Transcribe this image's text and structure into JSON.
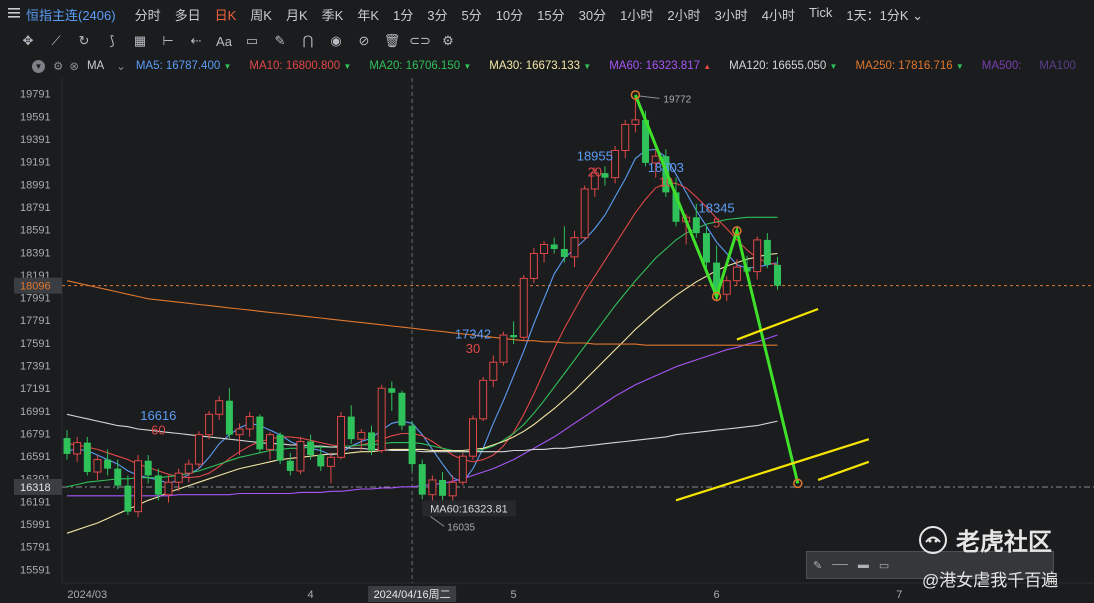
{
  "toolbar": {
    "symbol": "恒指主连(2406)",
    "periods": [
      "分时",
      "多日",
      "日K",
      "周K",
      "月K",
      "季K",
      "年K",
      "1分",
      "3分",
      "5分",
      "10分",
      "15分",
      "30分",
      "1小时",
      "2小时",
      "3小时",
      "4小时",
      "Tick",
      "1天：1分K ⌄"
    ],
    "active_period": "日K",
    "tools": [
      "move-icon",
      "line-tool-icon",
      "curve-icon",
      "zigzag-icon",
      "grid-icon",
      "measure-icon",
      "arrow-icon",
      "text-icon",
      "comment-icon",
      "pen-icon",
      "magnet-icon",
      "eye-icon",
      "hide-icon",
      "trash-icon",
      "toggle-icon",
      "settings-icon"
    ]
  },
  "indicator_bar": {
    "name": "MA",
    "items": [
      {
        "label": "MA5:",
        "value": "16787.400",
        "color": "#5b9df5",
        "arrow": "▼"
      },
      {
        "label": "MA10:",
        "value": "16800.800",
        "color": "#e04848",
        "arrow": "▼"
      },
      {
        "label": "MA20:",
        "value": "16706.150",
        "color": "#2fc15a",
        "arrow": "▼"
      },
      {
        "label": "MA30:",
        "value": "16673.133",
        "color": "#f3e7a5",
        "arrow": "▼"
      },
      {
        "label": "MA60:",
        "value": "16323.817",
        "color": "#a855f7",
        "arrow": "▲"
      },
      {
        "label": "MA120:",
        "value": "16655.050",
        "color": "#d6d6d6",
        "arrow": "▼"
      },
      {
        "label": "MA250:",
        "value": "17816.716",
        "color": "#e0772e",
        "arrow": "▼"
      },
      {
        "label": "MA500:",
        "value": "",
        "color": "#7a3fb0",
        "arrow": ""
      },
      {
        "label": "MA100",
        "value": "",
        "color": "#5a3f8a",
        "arrow": ""
      }
    ]
  },
  "chart_data": {
    "type": "candlestick",
    "y_ticks": [
      19791,
      19591,
      19391,
      19191,
      18991,
      18791,
      18591,
      18391,
      18191,
      17991,
      17791,
      17591,
      17391,
      17191,
      16991,
      16791,
      16591,
      16391,
      16191,
      15991,
      15791,
      15591
    ],
    "ylim": [
      15470,
      19930
    ],
    "x_labels": [
      {
        "i": 2,
        "text": "2024/03"
      },
      {
        "i": 24,
        "text": "4"
      },
      {
        "i": 34,
        "text": "2024/04/16周二",
        "highlight": true
      },
      {
        "i": 44,
        "text": "5"
      },
      {
        "i": 64,
        "text": "6"
      },
      {
        "i": 82,
        "text": "7"
      }
    ],
    "current_price": 18096,
    "crosshair_price": 16318,
    "crosshair_index": 34,
    "crosshair_ma_label": "MA60:16323.81",
    "low_label": "16035",
    "high_label": "19772",
    "candles": [
      [
        16750,
        16820,
        16560,
        16610
      ],
      [
        16610,
        16760,
        16540,
        16710
      ],
      [
        16710,
        16760,
        16420,
        16450
      ],
      [
        16450,
        16600,
        16380,
        16560
      ],
      [
        16560,
        16650,
        16420,
        16480
      ],
      [
        16480,
        16560,
        16300,
        16330
      ],
      [
        16330,
        16420,
        16070,
        16100
      ],
      [
        16100,
        16600,
        16050,
        16550
      ],
      [
        16550,
        16600,
        16350,
        16420
      ],
      [
        16420,
        16480,
        16200,
        16250
      ],
      [
        16250,
        16420,
        16180,
        16360
      ],
      [
        16360,
        16480,
        16280,
        16440
      ],
      [
        16440,
        16560,
        16360,
        16520
      ],
      [
        16520,
        16810,
        16480,
        16780
      ],
      [
        16780,
        16990,
        16740,
        16960
      ],
      [
        16960,
        17120,
        16910,
        17080
      ],
      [
        17080,
        17190,
        16750,
        16780
      ],
      [
        16780,
        16880,
        16600,
        16830
      ],
      [
        16830,
        16980,
        16760,
        16940
      ],
      [
        16940,
        16960,
        16620,
        16650
      ],
      [
        16650,
        16800,
        16560,
        16780
      ],
      [
        16780,
        16800,
        16520,
        16550
      ],
      [
        16550,
        16620,
        16420,
        16460
      ],
      [
        16460,
        16760,
        16430,
        16720
      ],
      [
        16720,
        16780,
        16560,
        16600
      ],
      [
        16600,
        16680,
        16460,
        16500
      ],
      [
        16500,
        16620,
        16350,
        16580
      ],
      [
        16580,
        16980,
        16560,
        16940
      ],
      [
        16940,
        17040,
        16700,
        16740
      ],
      [
        16740,
        16830,
        16640,
        16800
      ],
      [
        16800,
        16860,
        16600,
        16640
      ],
      [
        16640,
        17220,
        16620,
        17190
      ],
      [
        17190,
        17250,
        16990,
        17150
      ],
      [
        17150,
        17170,
        16820,
        16860
      ],
      [
        16860,
        16900,
        16460,
        16520
      ],
      [
        16520,
        16560,
        16210,
        16250
      ],
      [
        16250,
        16420,
        16110,
        16380
      ],
      [
        16380,
        16450,
        16200,
        16240
      ],
      [
        16240,
        16420,
        16180,
        16360
      ],
      [
        16360,
        16620,
        16330,
        16590
      ],
      [
        16590,
        16950,
        16560,
        16920
      ],
      [
        16920,
        17290,
        16900,
        17260
      ],
      [
        17260,
        17480,
        17200,
        17420
      ],
      [
        17420,
        17690,
        17390,
        17660
      ],
      [
        17660,
        17780,
        17580,
        17640
      ],
      [
        17640,
        18190,
        17610,
        18160
      ],
      [
        18160,
        18430,
        18120,
        18380
      ],
      [
        18380,
        18490,
        18300,
        18460
      ],
      [
        18460,
        18520,
        18380,
        18420
      ],
      [
        18420,
        18620,
        18300,
        18350
      ],
      [
        18350,
        18580,
        18260,
        18520
      ],
      [
        18520,
        18980,
        18500,
        18950
      ],
      [
        18950,
        19140,
        18880,
        19090
      ],
      [
        19090,
        19150,
        18980,
        19050
      ],
      [
        19050,
        19330,
        19000,
        19290
      ],
      [
        19290,
        19560,
        19220,
        19520
      ],
      [
        19520,
        19770,
        19450,
        19560
      ],
      [
        19560,
        19640,
        19150,
        19180
      ],
      [
        19180,
        19300,
        19050,
        19240
      ],
      [
        19240,
        19300,
        18880,
        18920
      ],
      [
        18920,
        19050,
        18620,
        18660
      ],
      [
        18660,
        18730,
        18460,
        18700
      ],
      [
        18700,
        18820,
        18520,
        18560
      ],
      [
        18560,
        18620,
        18250,
        18300
      ],
      [
        18300,
        18450,
        18000,
        18020
      ],
      [
        18020,
        18180,
        17960,
        18140
      ],
      [
        18140,
        18330,
        18100,
        18260
      ],
      [
        18260,
        18360,
        18180,
        18220
      ],
      [
        18220,
        18530,
        18150,
        18500
      ],
      [
        18500,
        18560,
        18250,
        18280
      ],
      [
        18280,
        18350,
        18060,
        18096
      ]
    ],
    "series": [
      {
        "name": "MA5",
        "color": "#5b9df5",
        "values": [
          16640,
          16650,
          16640,
          16600,
          16560,
          16520,
          16460,
          16420,
          16400,
          16380,
          16350,
          16380,
          16430,
          16480,
          16580,
          16700,
          16780,
          16840,
          16880,
          16860,
          16820,
          16780,
          16720,
          16680,
          16660,
          16640,
          16600,
          16620,
          16680,
          16720,
          16750,
          16820,
          16880,
          16900,
          16880,
          16780,
          16650,
          16520,
          16400,
          16360,
          16480,
          16660,
          16880,
          17080,
          17300,
          17520,
          17760,
          17980,
          18200,
          18340,
          18420,
          18500,
          18600,
          18720,
          18880,
          19040,
          19220,
          19290,
          19300,
          19230,
          19080,
          18920,
          18760,
          18620,
          18480,
          18380,
          18280,
          18250,
          18260,
          18280,
          18300
        ]
      },
      {
        "name": "MA10",
        "color": "#e04848",
        "values": [
          16700,
          16690,
          16670,
          16650,
          16620,
          16590,
          16560,
          16520,
          16490,
          16460,
          16430,
          16410,
          16400,
          16410,
          16440,
          16500,
          16570,
          16630,
          16680,
          16720,
          16740,
          16760,
          16760,
          16750,
          16730,
          16710,
          16690,
          16680,
          16680,
          16690,
          16710,
          16740,
          16770,
          16790,
          16790,
          16770,
          16720,
          16660,
          16600,
          16560,
          16540,
          16560,
          16600,
          16680,
          16800,
          16960,
          17140,
          17340,
          17540,
          17720,
          17880,
          18040,
          18180,
          18320,
          18460,
          18600,
          18740,
          18860,
          18960,
          19000,
          19000,
          18960,
          18880,
          18790,
          18690,
          18600,
          18500,
          18410,
          18340,
          18300,
          18280
        ]
      },
      {
        "name": "MA20",
        "color": "#2fc15a",
        "values": [
          16320,
          16340,
          16360,
          16370,
          16380,
          16390,
          16390,
          16400,
          16400,
          16400,
          16410,
          16420,
          16440,
          16460,
          16490,
          16520,
          16550,
          16580,
          16600,
          16620,
          16640,
          16650,
          16660,
          16660,
          16670,
          16670,
          16670,
          16680,
          16680,
          16690,
          16690,
          16700,
          16710,
          16710,
          16710,
          16700,
          16680,
          16660,
          16640,
          16630,
          16630,
          16650,
          16680,
          16730,
          16790,
          16870,
          16970,
          17080,
          17200,
          17320,
          17440,
          17560,
          17680,
          17800,
          17920,
          18030,
          18140,
          18240,
          18340,
          18420,
          18500,
          18560,
          18600,
          18640,
          18660,
          18680,
          18690,
          18700,
          18700,
          18700,
          18700
        ]
      },
      {
        "name": "MA30",
        "color": "#f3e7a5",
        "values": [
          15910,
          15940,
          15970,
          16000,
          16040,
          16080,
          16120,
          16160,
          16200,
          16230,
          16270,
          16300,
          16330,
          16360,
          16390,
          16420,
          16450,
          16480,
          16500,
          16520,
          16540,
          16560,
          16570,
          16580,
          16590,
          16600,
          16610,
          16610,
          16620,
          16630,
          16630,
          16640,
          16650,
          16650,
          16650,
          16650,
          16640,
          16640,
          16640,
          16640,
          16650,
          16660,
          16690,
          16720,
          16760,
          16810,
          16870,
          16940,
          17010,
          17090,
          17170,
          17260,
          17350,
          17440,
          17530,
          17620,
          17710,
          17790,
          17870,
          17940,
          18010,
          18070,
          18130,
          18180,
          18230,
          18270,
          18300,
          18330,
          18350,
          18370,
          18380
        ]
      },
      {
        "name": "MA60",
        "color": "#a855f7",
        "values": [
          16240,
          16240,
          16240,
          16240,
          16240,
          16240,
          16240,
          16240,
          16240,
          16240,
          16240,
          16250,
          16250,
          16250,
          16250,
          16250,
          16250,
          16260,
          16260,
          16260,
          16260,
          16260,
          16260,
          16270,
          16270,
          16270,
          16280,
          16280,
          16290,
          16300,
          16300,
          16310,
          16310,
          16320,
          16320,
          16330,
          16340,
          16350,
          16370,
          16390,
          16420,
          16450,
          16480,
          16520,
          16560,
          16610,
          16660,
          16710,
          16760,
          16820,
          16880,
          16940,
          17000,
          17060,
          17120,
          17170,
          17220,
          17260,
          17300,
          17340,
          17380,
          17410,
          17440,
          17470,
          17500,
          17530,
          17550,
          17580,
          17600,
          17630,
          17660
        ]
      },
      {
        "name": "MA120",
        "color": "#d6d6d6",
        "values": [
          16960,
          16940,
          16920,
          16900,
          16880,
          16860,
          16850,
          16830,
          16820,
          16810,
          16800,
          16790,
          16780,
          16770,
          16760,
          16750,
          16740,
          16730,
          16720,
          16710,
          16700,
          16700,
          16690,
          16690,
          16680,
          16680,
          16670,
          16670,
          16660,
          16660,
          16650,
          16650,
          16640,
          16640,
          16640,
          16630,
          16630,
          16630,
          16630,
          16630,
          16630,
          16630,
          16630,
          16630,
          16640,
          16640,
          16650,
          16650,
          16660,
          16660,
          16670,
          16680,
          16690,
          16700,
          16710,
          16720,
          16730,
          16740,
          16750,
          16760,
          16780,
          16790,
          16800,
          16810,
          16820,
          16830,
          16840,
          16850,
          16860,
          16880,
          16900
        ]
      },
      {
        "name": "MA250",
        "color": "#e0772e",
        "values": [
          18140,
          18120,
          18100,
          18080,
          18060,
          18040,
          18020,
          18000,
          17980,
          17970,
          17960,
          17950,
          17940,
          17930,
          17920,
          17910,
          17900,
          17890,
          17880,
          17870,
          17860,
          17850,
          17840,
          17830,
          17820,
          17810,
          17800,
          17790,
          17780,
          17770,
          17760,
          17750,
          17740,
          17730,
          17720,
          17710,
          17700,
          17690,
          17680,
          17670,
          17660,
          17650,
          17640,
          17630,
          17620,
          17610,
          17610,
          17600,
          17600,
          17590,
          17590,
          17590,
          17580,
          17580,
          17580,
          17580,
          17580,
          17570,
          17570,
          17570,
          17570,
          17570,
          17570,
          17570,
          17570,
          17570,
          17570,
          17570,
          17570,
          17570,
          17570
        ]
      }
    ],
    "ma_labels": [
      {
        "i": 9,
        "price": 16910,
        "text": "16616",
        "color": "#5b9df5"
      },
      {
        "i": 9,
        "price": 16780,
        "text": "60",
        "color": "#e04848"
      },
      {
        "i": 40,
        "price": 17630,
        "text": "17342",
        "color": "#5b9df5"
      },
      {
        "i": 40,
        "price": 17500,
        "text": "30",
        "color": "#e04848"
      },
      {
        "i": 52,
        "price": 19200,
        "text": "18955",
        "color": "#5b9df5"
      },
      {
        "i": 52,
        "price": 19060,
        "text": "20",
        "color": "#e04848"
      },
      {
        "i": 59,
        "price": 19100,
        "text": "18803",
        "color": "#5b9df5"
      },
      {
        "i": 59,
        "price": 18970,
        "text": "10",
        "color": "#e04848"
      },
      {
        "i": 64,
        "price": 18740,
        "text": "18345",
        "color": "#5b9df5"
      },
      {
        "i": 64,
        "price": 18610,
        "text": "5",
        "color": "#e04848"
      }
    ],
    "drawing": {
      "pattern": [
        [
          56,
          19780
        ],
        [
          64,
          18000
        ],
        [
          66,
          18580
        ],
        [
          72,
          16350
        ]
      ],
      "channel_upper": [
        [
          66,
          17620
        ],
        [
          74,
          17890
        ]
      ],
      "channel_lower": [
        [
          60,
          16200
        ],
        [
          79,
          16740
        ]
      ],
      "lower_extension": [
        [
          74,
          16380
        ],
        [
          79,
          16540
        ]
      ]
    }
  },
  "watermark": {
    "brand": "老虎社区",
    "author": "@港女虐我千百遍"
  }
}
